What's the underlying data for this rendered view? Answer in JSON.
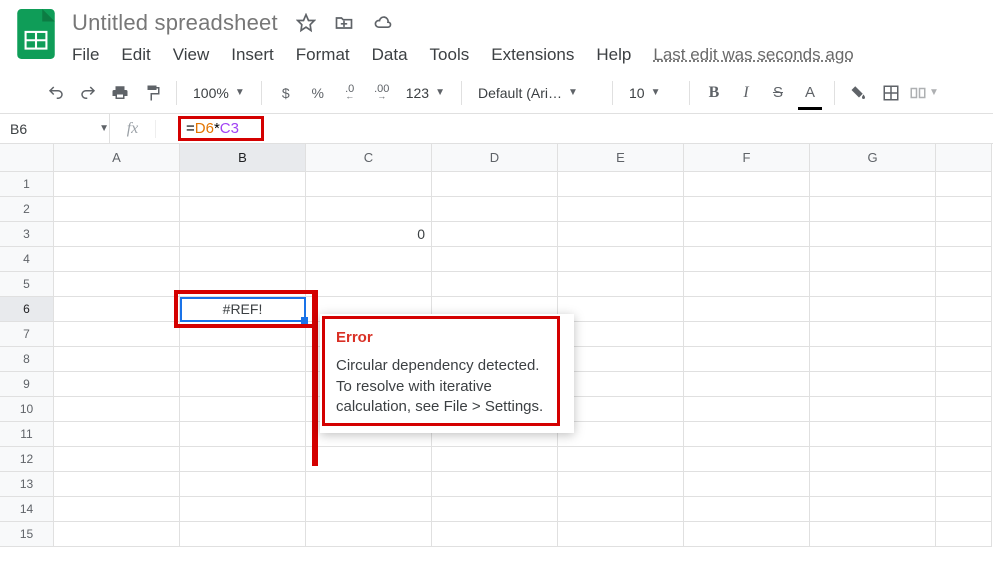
{
  "header": {
    "title": "Untitled spreadsheet",
    "menus": [
      "File",
      "Edit",
      "View",
      "Insert",
      "Format",
      "Data",
      "Tools",
      "Extensions",
      "Help"
    ],
    "last_edit": "Last edit was seconds ago"
  },
  "toolbar": {
    "zoom": "100%",
    "currency": "$",
    "percent": "%",
    "dec_dec": ".0",
    "inc_dec": ".00",
    "num_fmt": "123",
    "font": "Default (Ari…",
    "font_size": "10",
    "bold": "B",
    "italic": "I",
    "strike": "S",
    "text_color": "A"
  },
  "formula_bar": {
    "cell_ref": "B6",
    "fx": "fx",
    "eq": "=",
    "ref1": "D6",
    "op": "*",
    "ref2": "C3"
  },
  "grid": {
    "columns": [
      "A",
      "B",
      "C",
      "D",
      "E",
      "F",
      "G"
    ],
    "rows": [
      "1",
      "2",
      "3",
      "4",
      "5",
      "6",
      "7",
      "8",
      "9",
      "10",
      "11",
      "12",
      "13",
      "14",
      "15"
    ],
    "selected_col_index": 1,
    "selected_row_index": 5,
    "cells": {
      "C3": "0",
      "B6": "#REF!"
    }
  },
  "tooltip": {
    "title": "Error",
    "message": "Circular dependency detected. To resolve with iterative calculation, see File > Settings."
  }
}
